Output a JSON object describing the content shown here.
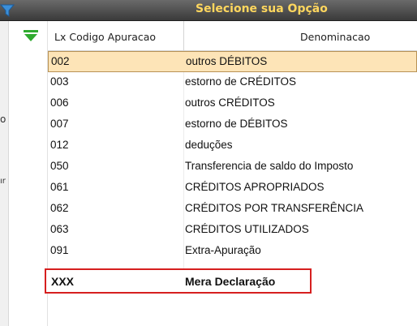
{
  "window": {
    "title": "Selecione sua Opção",
    "left_edge_chars": [
      "o",
      "ır"
    ]
  },
  "icons": {
    "filter": "filter-icon",
    "sort_down": "sort-down-icon"
  },
  "colors": {
    "title_text": "#ffd75e",
    "selected_row": "#fde4b7",
    "highlight_border": "#d61f1f"
  },
  "table": {
    "headers": {
      "code": "Lx Codigo Apuracao",
      "name": "Denominacao"
    },
    "rows": [
      {
        "code": "002",
        "name": "outros DÉBITOS"
      },
      {
        "code": "003",
        "name": "estorno de CRÉDITOS"
      },
      {
        "code": "006",
        "name": "outros CRÉDITOS"
      },
      {
        "code": "007",
        "name": "estorno de DÉBITOS"
      },
      {
        "code": "012",
        "name": "deduções"
      },
      {
        "code": "050",
        "name": "Transferencia de saldo do Imposto"
      },
      {
        "code": "061",
        "name": "CRÉDITOS APROPRIADOS"
      },
      {
        "code": "062",
        "name": "CRÉDITOS POR TRANSFERÊNCIA"
      },
      {
        "code": "063",
        "name": "CRÉDITOS UTILIZADOS"
      },
      {
        "code": "091",
        "name": "Extra-Apuração"
      }
    ],
    "highlighted": {
      "code": "XXX",
      "name": "Mera Declaração"
    }
  }
}
